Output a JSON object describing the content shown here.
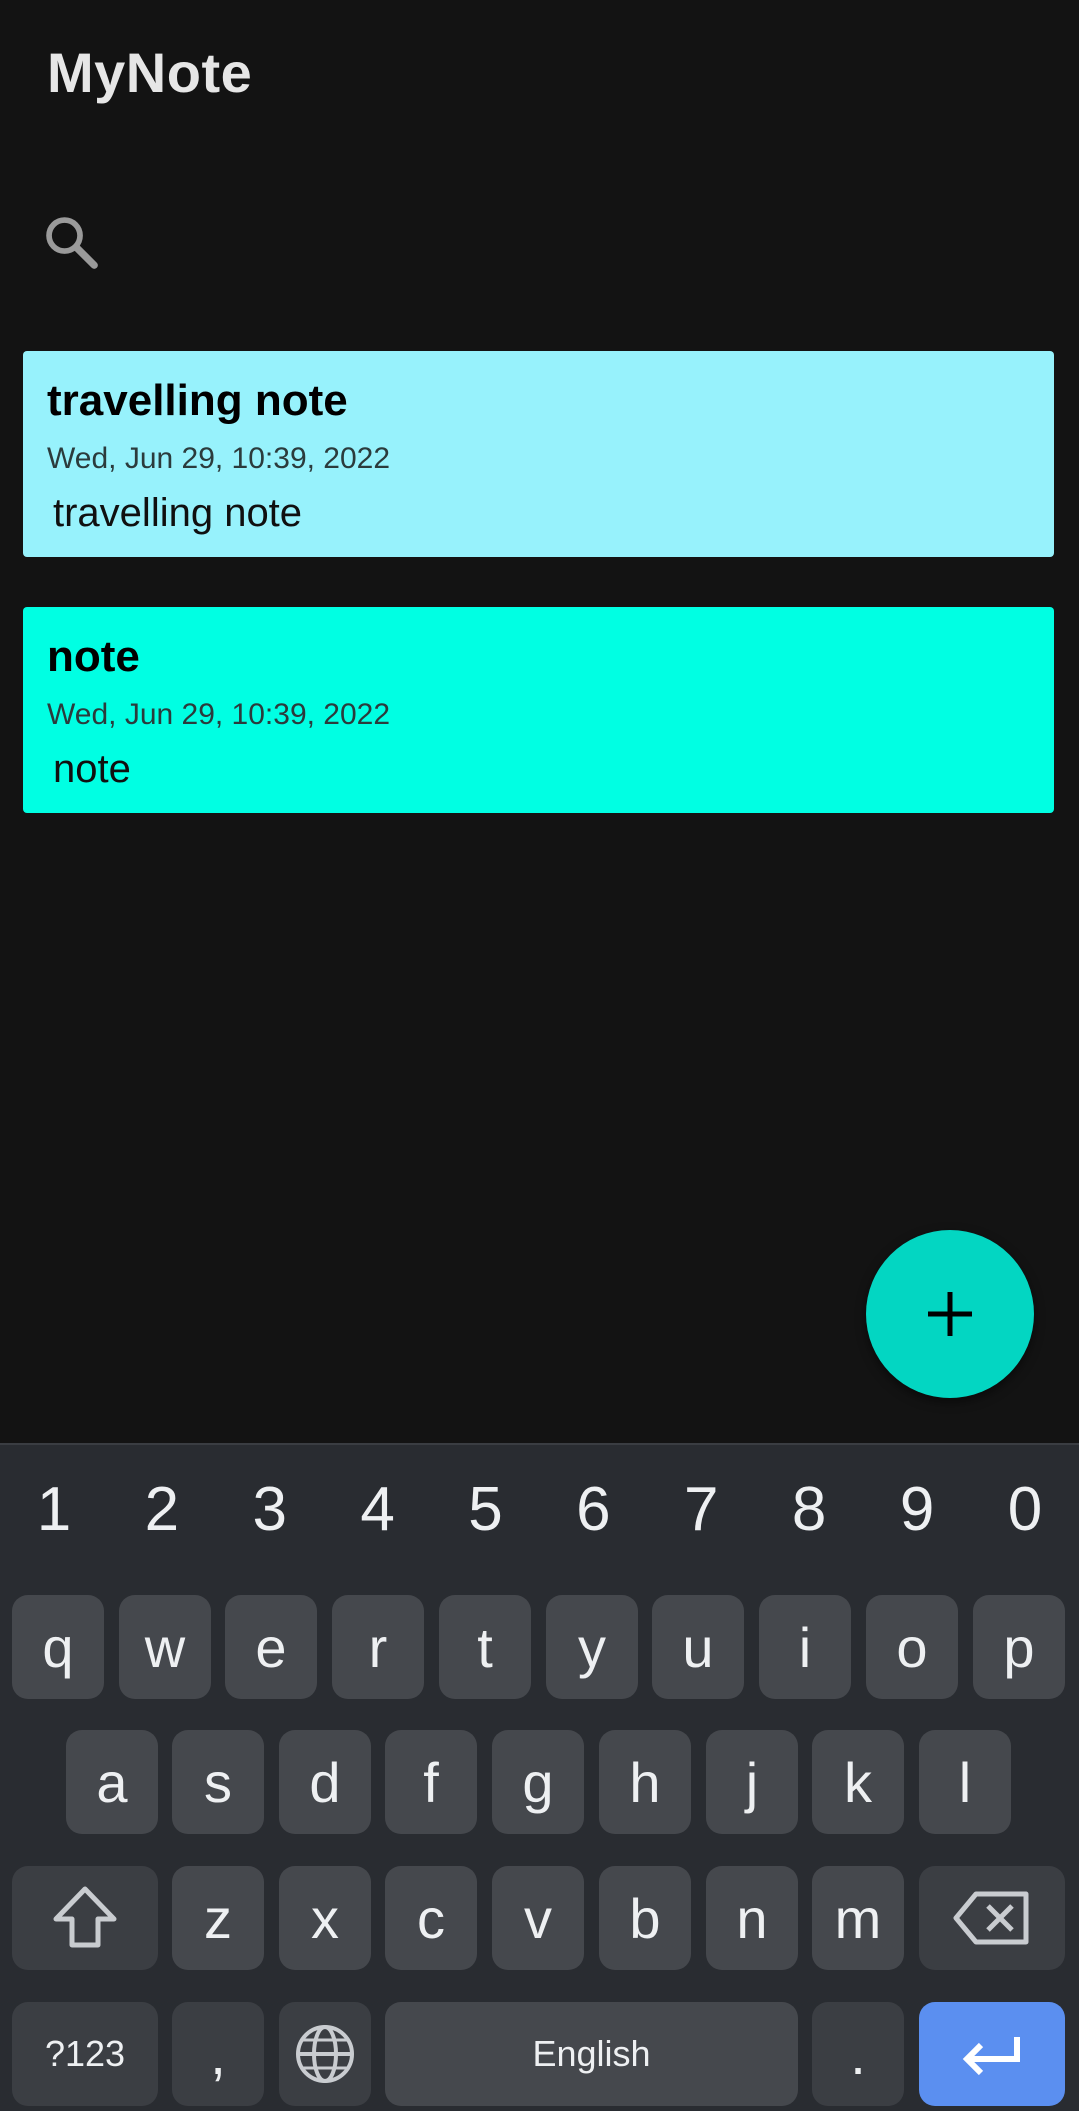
{
  "app": {
    "title": "MyNote"
  },
  "search": {
    "icon": "search-icon"
  },
  "notes": [
    {
      "title": "travelling note",
      "date": "Wed, Jun 29, 10:39, 2022",
      "body": "travelling note",
      "color": "#97f2fc"
    },
    {
      "title": "note",
      "date": "Wed, Jun 29, 10:39, 2022",
      "body": "note",
      "color": "#00ffe3"
    }
  ],
  "fab": {
    "icon": "plus-icon",
    "color": "#03d6c2"
  },
  "keyboard": {
    "numbers": [
      "1",
      "2",
      "3",
      "4",
      "5",
      "6",
      "7",
      "8",
      "9",
      "0"
    ],
    "row1": [
      "q",
      "w",
      "e",
      "r",
      "t",
      "y",
      "u",
      "i",
      "o",
      "p"
    ],
    "row2": [
      "a",
      "s",
      "d",
      "f",
      "g",
      "h",
      "j",
      "k",
      "l"
    ],
    "row3": [
      "z",
      "x",
      "c",
      "v",
      "b",
      "n",
      "m"
    ],
    "symbols_label": "?123",
    "comma_label": ",",
    "space_label": "English",
    "period_label": ".",
    "enter_color": "#5b8ff0"
  }
}
